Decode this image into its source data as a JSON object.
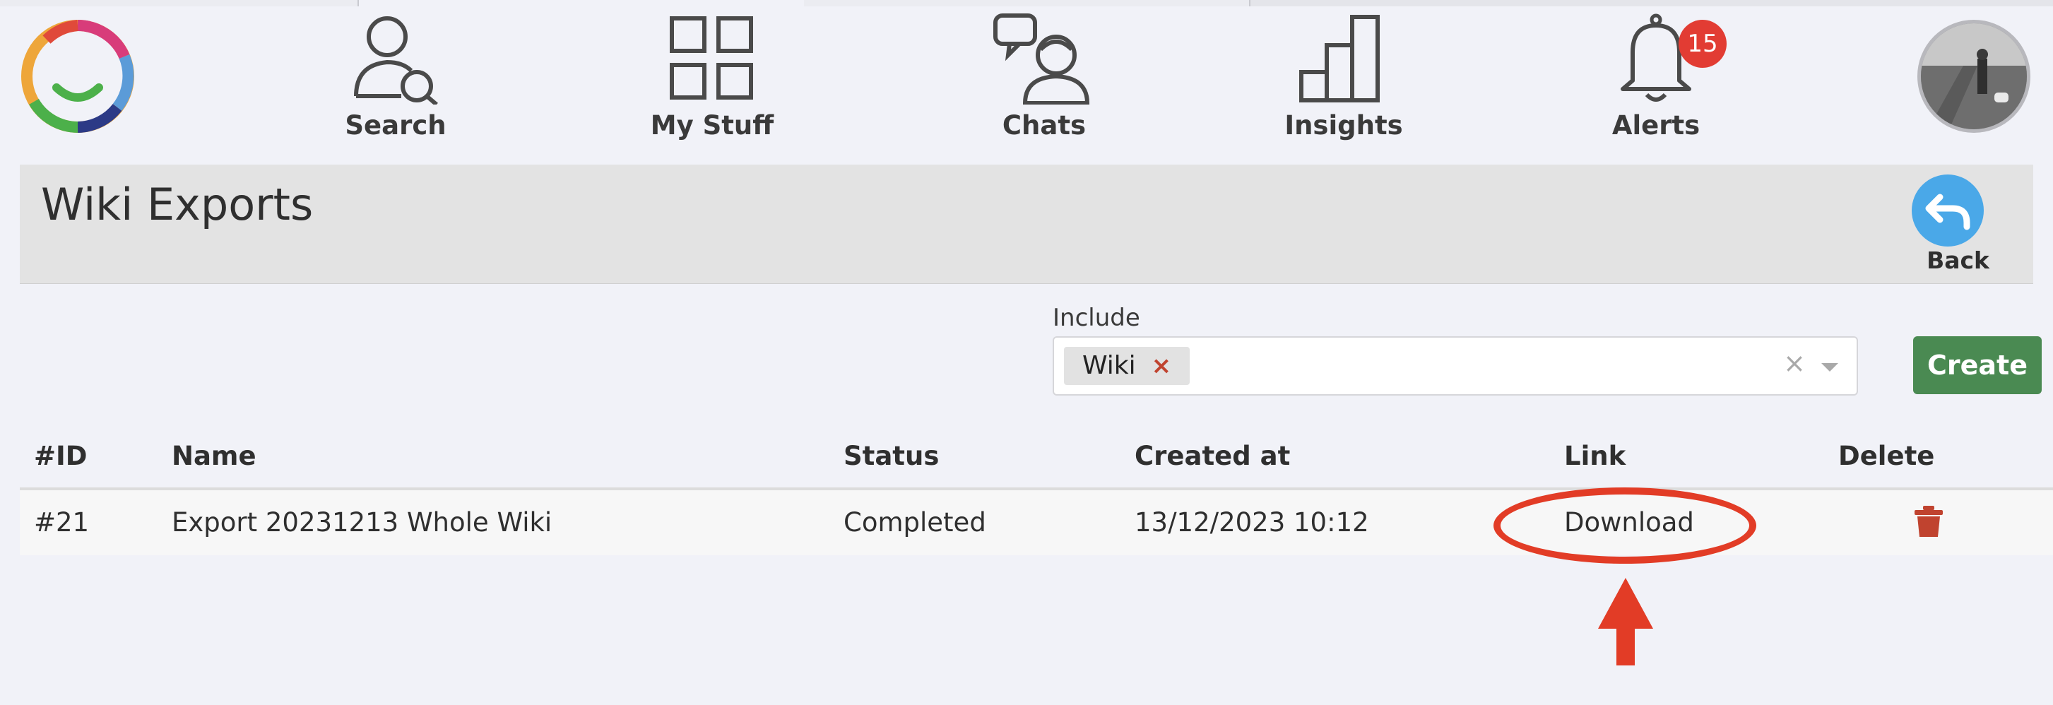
{
  "nav": {
    "items": [
      {
        "label": "Search",
        "icon": "person-search-icon"
      },
      {
        "label": "My Stuff",
        "icon": "grid-icon"
      },
      {
        "label": "Chats",
        "icon": "chat-person-icon"
      },
      {
        "label": "Insights",
        "icon": "bar-chart-icon"
      },
      {
        "label": "Alerts",
        "icon": "bell-icon"
      }
    ],
    "alerts_badge": "15"
  },
  "header": {
    "title": "Wiki Exports",
    "back_label": "Back"
  },
  "filter": {
    "include_label": "Include",
    "selected": [
      "Wiki"
    ],
    "chip_remove": "×",
    "clear": "×",
    "create_label": "Create"
  },
  "table": {
    "columns": [
      "#ID",
      "Name",
      "Status",
      "Created at",
      "Link",
      "Delete"
    ],
    "rows": [
      {
        "id": "#21",
        "name": "Export 20231213 Whole Wiki",
        "status": "Completed",
        "created_at": "13/12/2023 10:12",
        "link": "Download"
      }
    ]
  },
  "colors": {
    "background": "#f1f2f8",
    "header_bar": "#e3e3e3",
    "back_button": "#4aa8e8",
    "create_button": "#4a8a52",
    "badge": "#e23c33",
    "annotation": "#e23c26",
    "trash": "#c0432f"
  }
}
